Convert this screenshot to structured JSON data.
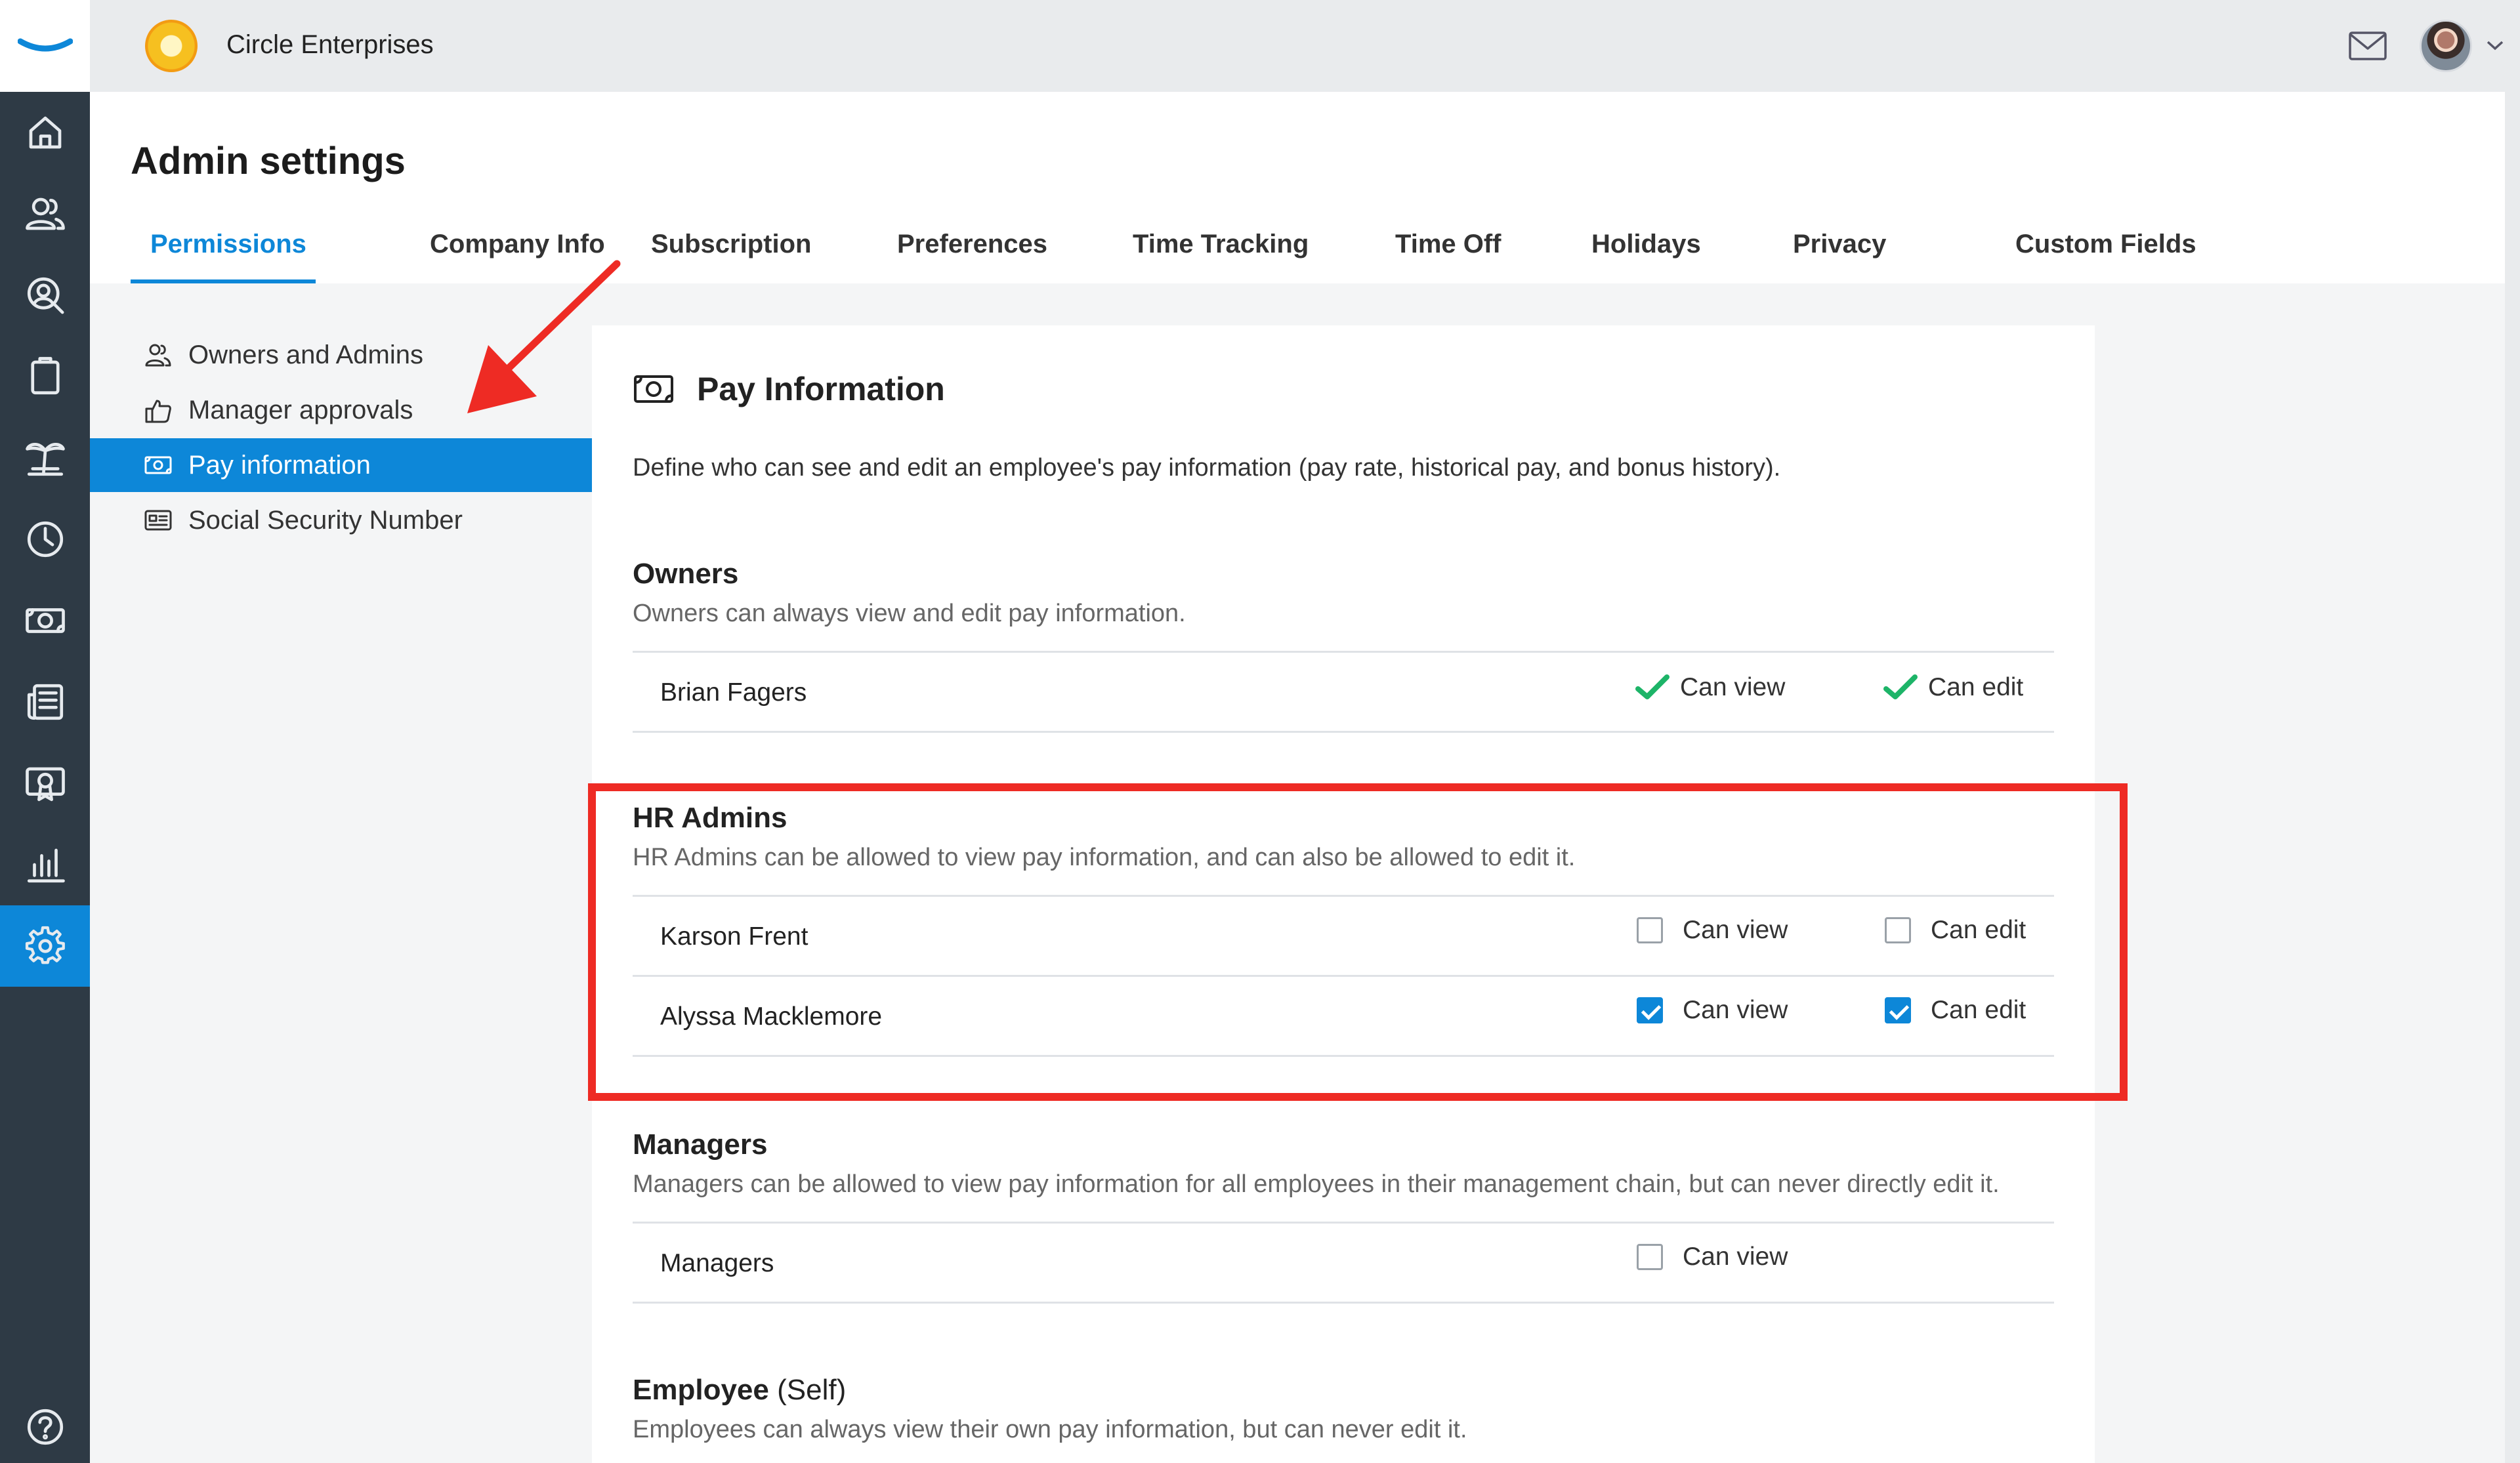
{
  "company": {
    "name": "Circle Enterprises"
  },
  "nav_rail": {
    "items": [
      {
        "icon": "home-icon"
      },
      {
        "icon": "people-icon"
      },
      {
        "icon": "user-search-icon"
      },
      {
        "icon": "clipboard-icon"
      },
      {
        "icon": "palm-tree-icon"
      },
      {
        "icon": "clock-icon"
      },
      {
        "icon": "money-icon"
      },
      {
        "icon": "news-icon"
      },
      {
        "icon": "certificate-icon"
      },
      {
        "icon": "bar-chart-icon"
      },
      {
        "icon": "gear-icon"
      },
      {
        "icon": "help-icon"
      }
    ]
  },
  "header": {
    "title": "Admin settings",
    "tabs": [
      {
        "label": "Permissions"
      },
      {
        "label": "Company Info"
      },
      {
        "label": "Subscription"
      },
      {
        "label": "Preferences"
      },
      {
        "label": "Time Tracking"
      },
      {
        "label": "Time Off"
      },
      {
        "label": "Holidays"
      },
      {
        "label": "Privacy"
      },
      {
        "label": "Custom Fields"
      }
    ],
    "active_tab": "Permissions"
  },
  "side_menu": {
    "items": [
      {
        "label": "Owners and Admins",
        "icon": "people-icon"
      },
      {
        "label": "Manager approvals",
        "icon": "thumbs-up-icon"
      },
      {
        "label": "Pay information",
        "icon": "money-icon"
      },
      {
        "label": "Social Security Number",
        "icon": "id-card-icon"
      }
    ],
    "active": "Pay information"
  },
  "pay_info": {
    "title": "Pay Information",
    "description": "Define who can see and edit an employee's pay information (pay rate, historical pay, and bonus history).",
    "sections": {
      "owners": {
        "title": "Owners",
        "subtitle": "Owners can always view and edit pay information.",
        "rows": [
          {
            "name": "Brian Fagers",
            "can_view": "Can view",
            "can_edit": "Can edit"
          }
        ]
      },
      "hr_admins": {
        "title": "HR Admins",
        "subtitle": "HR Admins can be allowed to view pay information, and can also be allowed to edit it.",
        "rows": [
          {
            "name": "Karson Frent",
            "can_view": "Can view",
            "can_edit": "Can edit",
            "view_checked": false,
            "edit_checked": false
          },
          {
            "name": "Alyssa Macklemore",
            "can_view": "Can view",
            "can_edit": "Can edit",
            "view_checked": true,
            "edit_checked": true
          }
        ]
      },
      "managers": {
        "title": "Managers",
        "subtitle": "Managers can be allowed to view pay information for all employees in their management chain, but can never directly edit it.",
        "rows": [
          {
            "name": "Managers",
            "can_view": "Can view",
            "view_checked": false
          }
        ]
      },
      "employee": {
        "title": "Employee",
        "title_suffix": "(Self)",
        "subtitle": "Employees can always view their own pay information, but can never edit it."
      }
    }
  },
  "colors": {
    "accent": "#0d87d8",
    "rail": "#2e3a45",
    "check_green": "#1db468",
    "annotation_red": "#ee2b24"
  }
}
